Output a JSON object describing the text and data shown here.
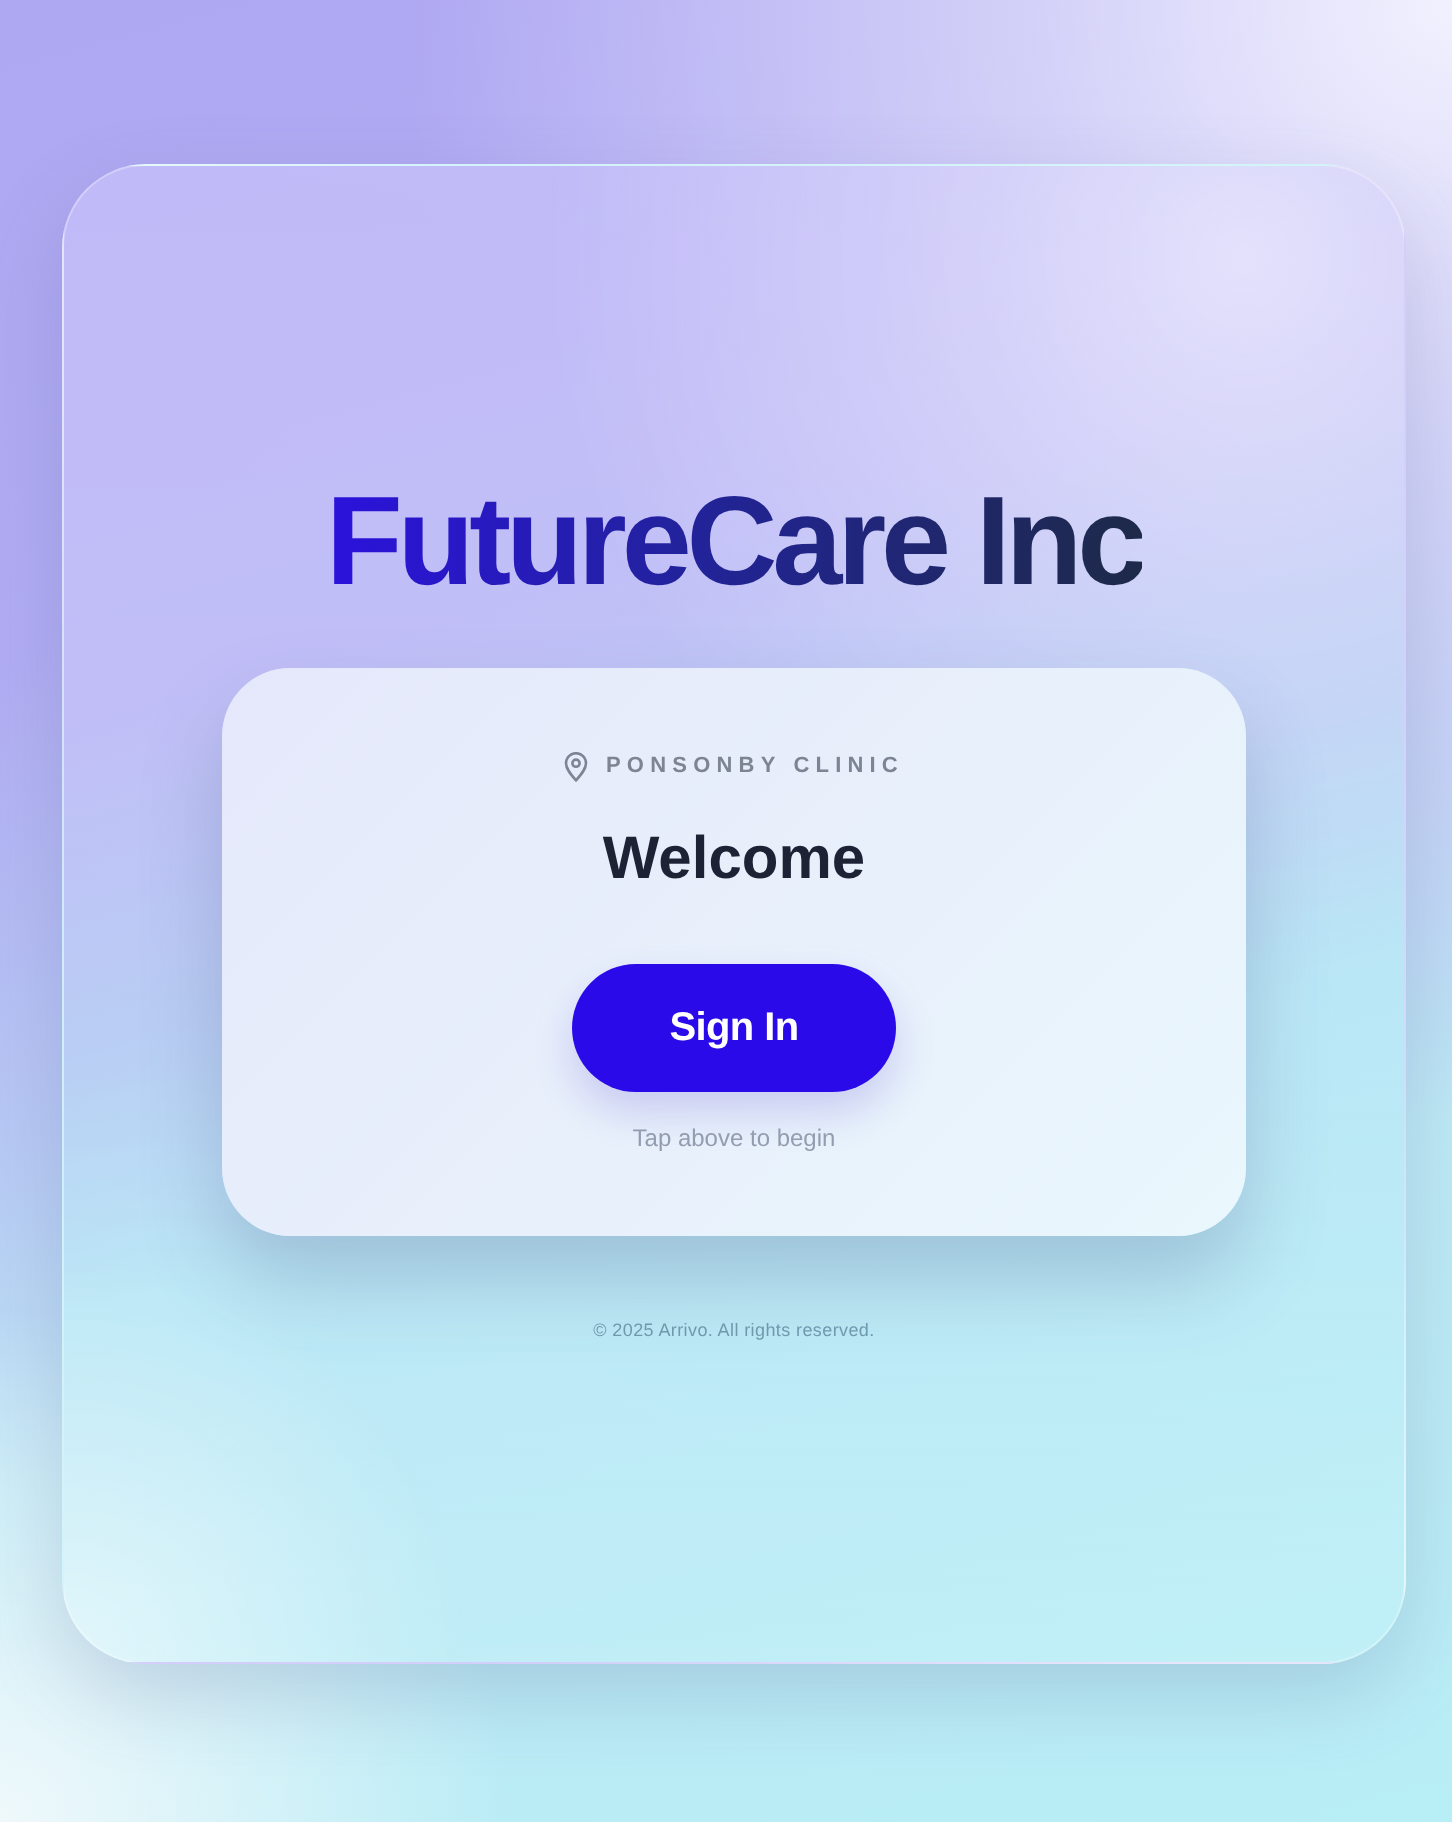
{
  "brand": {
    "title": "FutureCare Inc"
  },
  "card": {
    "location": "PONSONBY CLINIC",
    "heading": "Welcome",
    "button": "Sign In",
    "hint": "Tap above to begin"
  },
  "footer": "© 2025 Arrivo. All rights reserved."
}
